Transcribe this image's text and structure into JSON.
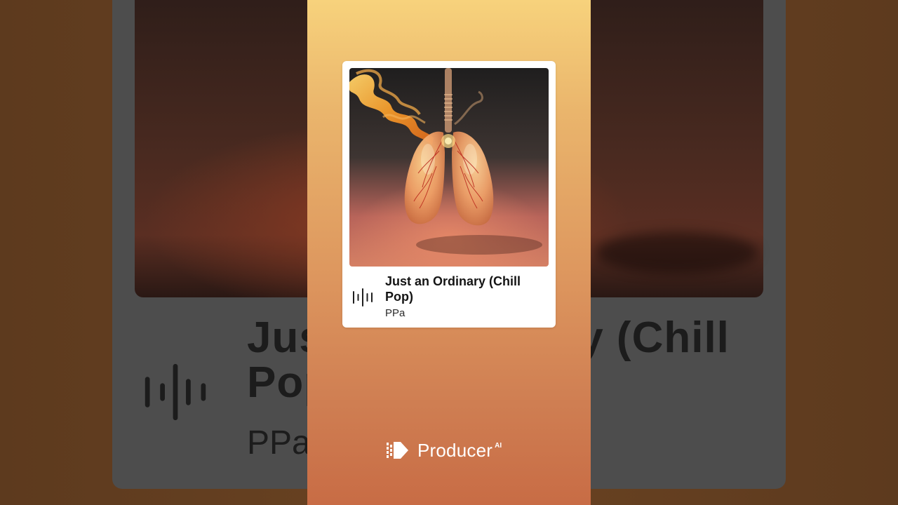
{
  "song": {
    "title": "Just an Ordinary (Chill Pop)",
    "artist": "PPa"
  },
  "background": {
    "title": "Just an Ordinary (Chill\nPop)",
    "artist": "PPa"
  },
  "brand": {
    "name": "Producer",
    "superscript": "AI"
  },
  "icons": {
    "waveform": "audio-waveform-icon",
    "brand_logo": "producer-logo-icon"
  },
  "colors": {
    "panel_top": "#f7d27c",
    "panel_bottom": "#c86c45",
    "card": "#ffffff",
    "text": "#141414"
  }
}
